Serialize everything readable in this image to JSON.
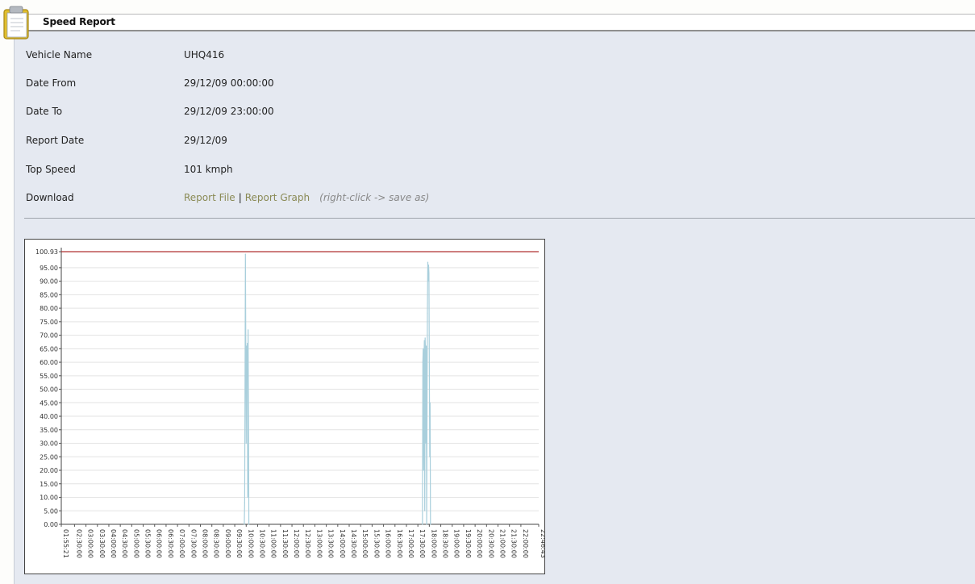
{
  "report": {
    "title": "Speed Report",
    "fields": [
      {
        "label": "Vehicle Name",
        "value": "UHQ416"
      },
      {
        "label": "Date From",
        "value": "29/12/09 00:00:00"
      },
      {
        "label": "Date To",
        "value": "29/12/09 23:00:00"
      },
      {
        "label": "Report Date",
        "value": "29/12/09"
      },
      {
        "label": "Top Speed",
        "value": "101 kmph"
      }
    ],
    "download": {
      "label": "Download",
      "report_file": "Report File",
      "separator": "|",
      "report_graph": "Report Graph",
      "hint": "(right-click -> save as)"
    }
  },
  "colors": {
    "panel_bg": "#e5e9f1",
    "link": "#8a8a55",
    "series": "#a9cfdc",
    "max_line": "#b03030"
  },
  "chart_data": {
    "type": "line",
    "y_tick_labels": [
      "0.00",
      "5.00",
      "10.00",
      "15.00",
      "20.00",
      "25.00",
      "30.00",
      "35.00",
      "40.00",
      "45.00",
      "50.00",
      "55.00",
      "60.00",
      "65.00",
      "70.00",
      "75.00",
      "80.00",
      "85.00",
      "90.00",
      "95.00",
      "100.93"
    ],
    "ylim": [
      0,
      100.93
    ],
    "x_tick_labels": [
      "01:55:21",
      "02:30:00",
      "03:00:00",
      "03:30:00",
      "04:00:00",
      "04:30:00",
      "05:00:00",
      "05:30:00",
      "06:00:00",
      "06:30:00",
      "07:00:00",
      "07:30:00",
      "08:00:00",
      "08:30:00",
      "09:00:00",
      "09:30:00",
      "10:00:00",
      "10:30:00",
      "11:00:00",
      "11:30:00",
      "12:00:00",
      "12:30:00",
      "13:00:00",
      "13:30:00",
      "14:00:00",
      "14:30:00",
      "15:00:00",
      "15:30:00",
      "16:00:00",
      "16:30:00",
      "17:00:00",
      "17:30:00",
      "18:00:00",
      "18:30:00",
      "19:00:00",
      "19:30:00",
      "20:00:00",
      "20:30:00",
      "21:00:00",
      "21:30:00",
      "22:00:00",
      "22:46:43"
    ],
    "max_line": 100.93,
    "grid": true,
    "series": [
      {
        "x": [
          "09:55:00",
          "09:56:00",
          "09:57:00",
          "09:58:00",
          "09:59:00",
          "10:00:00",
          "10:01:00",
          "10:02:00",
          "10:03:00",
          "10:04:00",
          "10:05:00",
          "10:06:00",
          "10:07:00",
          "17:42:00",
          "17:43:00",
          "17:44:00",
          "17:45:00",
          "17:46:00",
          "17:47:00",
          "17:48:00",
          "17:49:00",
          "17:50:00",
          "17:51:00",
          "17:52:00",
          "17:53:00",
          "17:54:00",
          "17:55:00",
          "17:56:00",
          "17:57:00",
          "17:58:00",
          "17:59:00",
          "18:00:00",
          "18:01:00",
          "18:02:00",
          "18:03:00"
        ],
        "y": [
          0,
          8,
          55,
          100,
          62,
          30,
          66,
          58,
          67,
          10,
          72,
          40,
          0,
          0,
          60,
          65,
          20,
          62,
          68,
          5,
          69,
          64,
          30,
          66,
          0,
          40,
          78,
          97,
          90,
          96,
          93,
          60,
          25,
          45,
          0
        ]
      }
    ]
  }
}
